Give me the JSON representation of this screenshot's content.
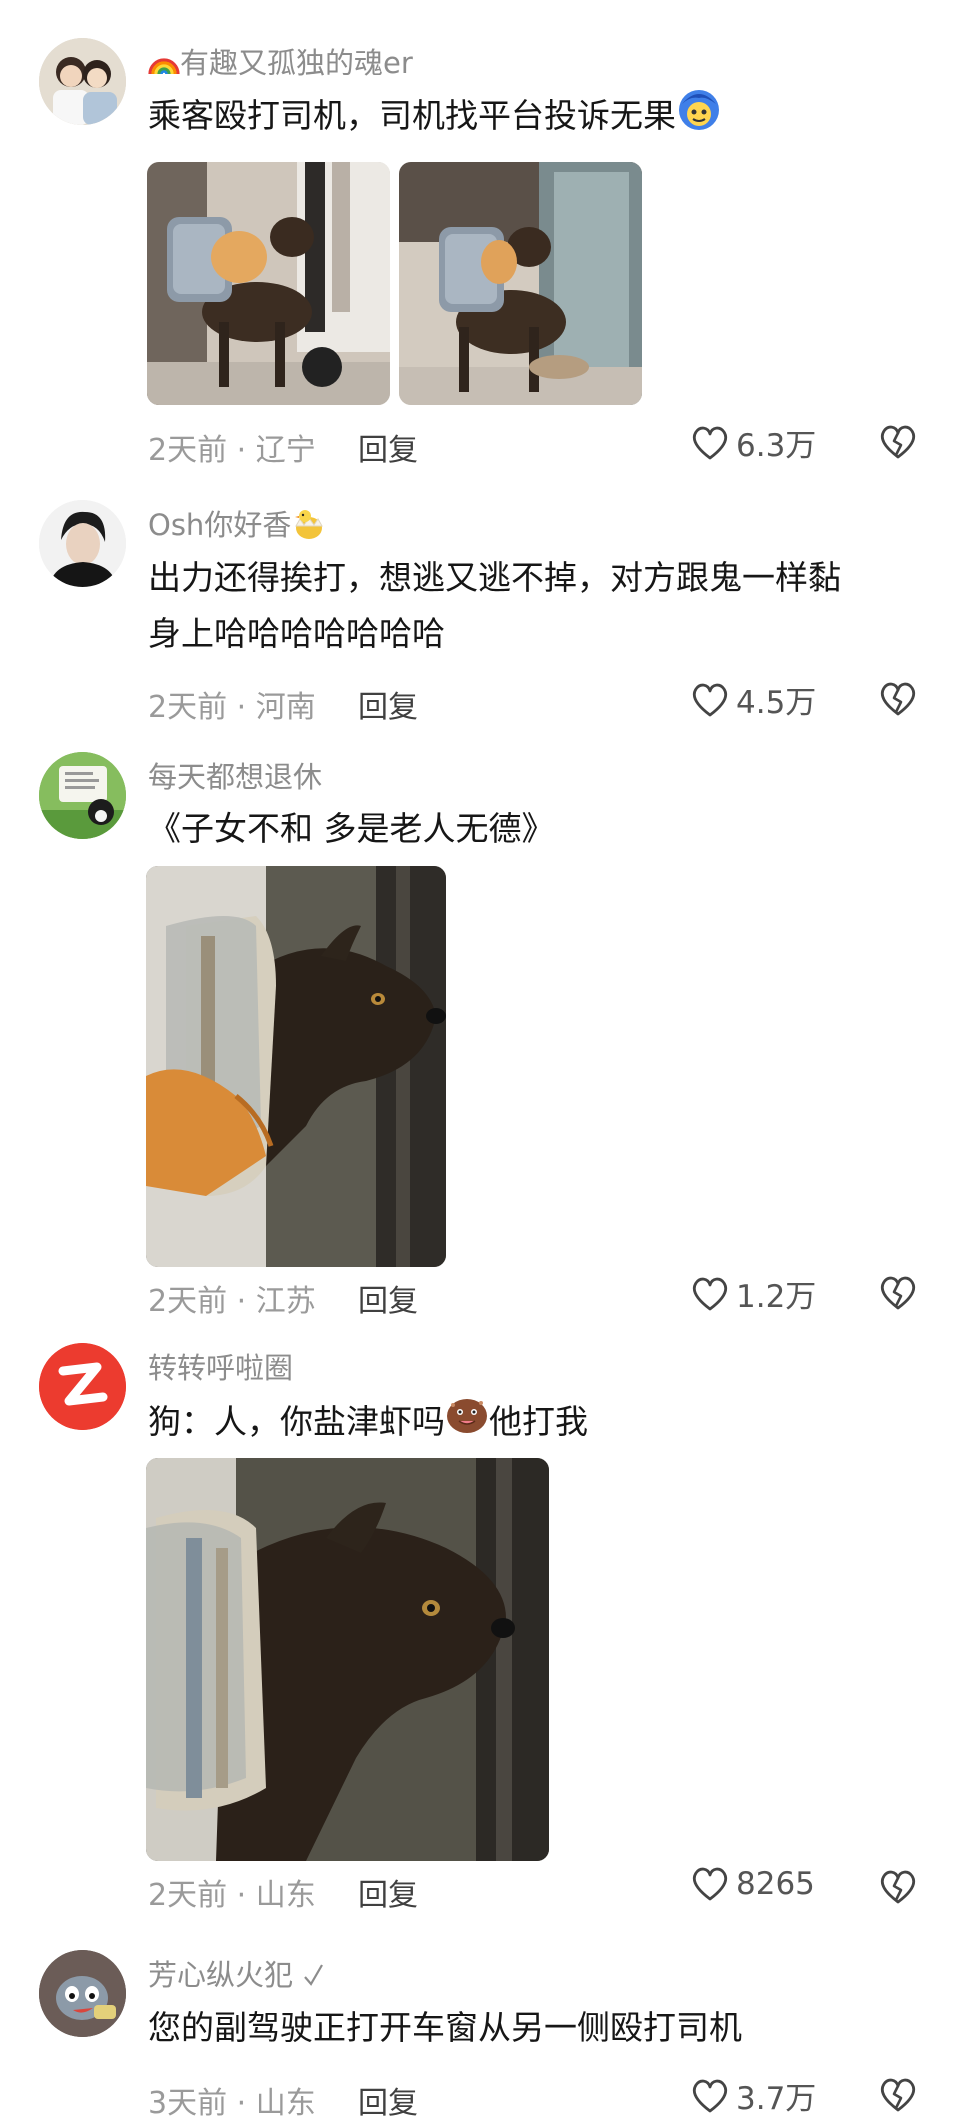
{
  "reply_label": "回复",
  "comments": [
    {
      "username": "有趣又孤独的魂er",
      "text": "乘客殴打司机，司机找平台投诉无果",
      "time_location": "2天前 · 辽宁",
      "likes": "6.3万"
    },
    {
      "username": "Osh你好香",
      "text_line1": "出力还得挨打，想逃又逃不掉，对方跟鬼一样黏",
      "text_line2": "身上哈哈哈哈哈哈哈",
      "time_location": "2天前 · 河南",
      "likes": "4.5万"
    },
    {
      "username": "每天都想退休",
      "text": "《子女不和 多是老人无德》",
      "time_location": "2天前 · 江苏",
      "likes": "1.2万"
    },
    {
      "username": "转转呼啦圈",
      "text_before": "狗：人，你盐津虾吗",
      "text_after": "他打我",
      "time_location": "2天前 · 山东",
      "likes": "8265"
    },
    {
      "username": "芳心纵火犯",
      "text": "您的副驾驶正打开车窗从另一侧殴打司机",
      "time_location": "3天前 · 山东",
      "likes": "3.7万"
    }
  ],
  "colors": {
    "meta": "#9a9a9a",
    "username": "#8c8c8c",
    "text": "#161616"
  },
  "icons": [
    "rainbow-icon",
    "blue-face-emoji-icon",
    "chick-emoji-icon",
    "cookie-face-emoji-icon",
    "heart-icon",
    "broken-heart-icon",
    "check-icon"
  ]
}
